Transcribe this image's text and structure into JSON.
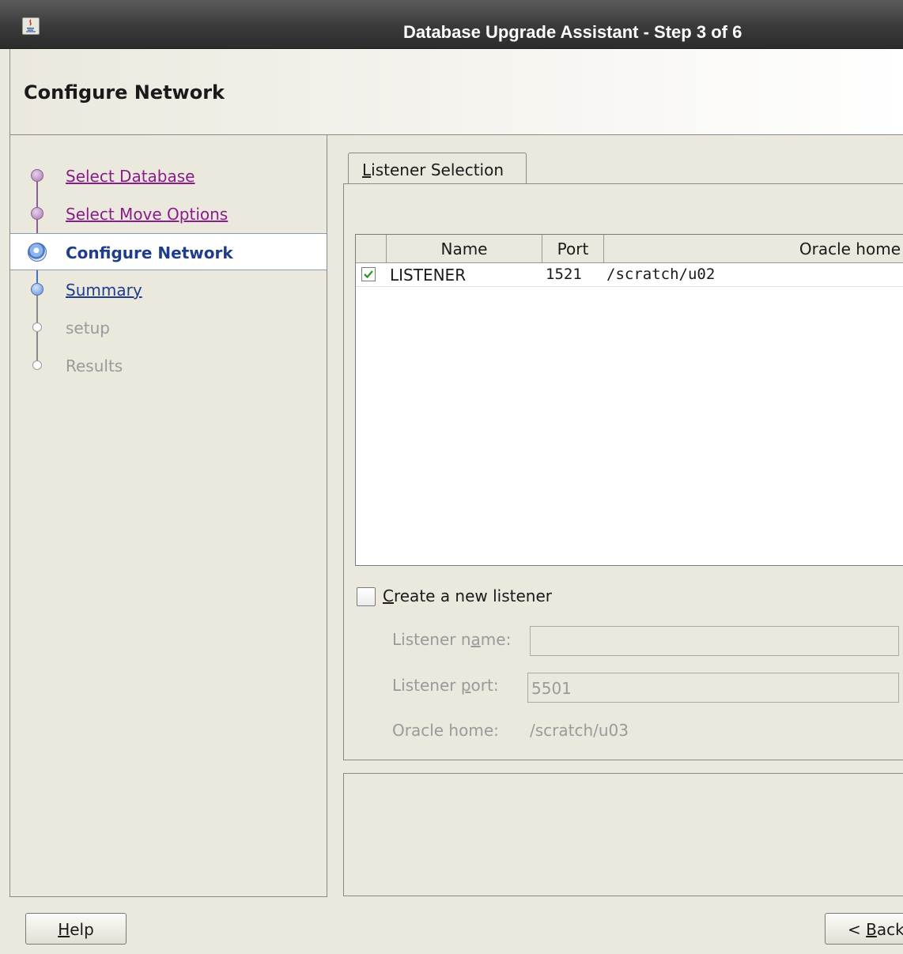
{
  "window": {
    "title": "Database Upgrade Assistant - Step 3 of 6",
    "app_icon": "java-icon"
  },
  "header": {
    "page_title": "Configure Network"
  },
  "nav": {
    "items": [
      {
        "label": "Select Database",
        "state": "visited"
      },
      {
        "label": "Select Move Options",
        "state": "visited"
      },
      {
        "label": "Configure Network",
        "state": "current"
      },
      {
        "label": "Summary",
        "state": "next"
      },
      {
        "label": "setup",
        "state": "disabled"
      },
      {
        "label": "Results",
        "state": "disabled"
      }
    ]
  },
  "tabs": [
    {
      "label_mnemonic": "L",
      "label_rest": "istener Selection",
      "selected": true
    }
  ],
  "listener_table": {
    "columns": [
      "Name",
      "Port",
      "Oracle home"
    ],
    "rows": [
      {
        "checked": true,
        "name": "LISTENER",
        "port": "1521",
        "oracle_home": "/scratch/u02"
      }
    ]
  },
  "new_listener": {
    "checkbox_checked": false,
    "checkbox_label_mnemonic": "C",
    "checkbox_label_rest": "reate a new listener",
    "name_label_pre": "Listener n",
    "name_label_mnemonic": "a",
    "name_label_post": "me:",
    "name_value": "",
    "port_label_pre": "Listener ",
    "port_label_mnemonic": "p",
    "port_label_post": "ort:",
    "port_value": "5501",
    "oracle_home_label": "Oracle home:",
    "oracle_home_value": "/scratch/u03"
  },
  "buttons": {
    "help_mnemonic": "H",
    "help_rest": "elp",
    "back_prefix": "< ",
    "back_mnemonic": "B",
    "back_rest": "ack"
  },
  "colors": {
    "visited_link": "#8b1d8b",
    "current_step": "#1f3d8a",
    "disabled_text": "#9a9a9a",
    "check_green": "#2e9b2e"
  }
}
